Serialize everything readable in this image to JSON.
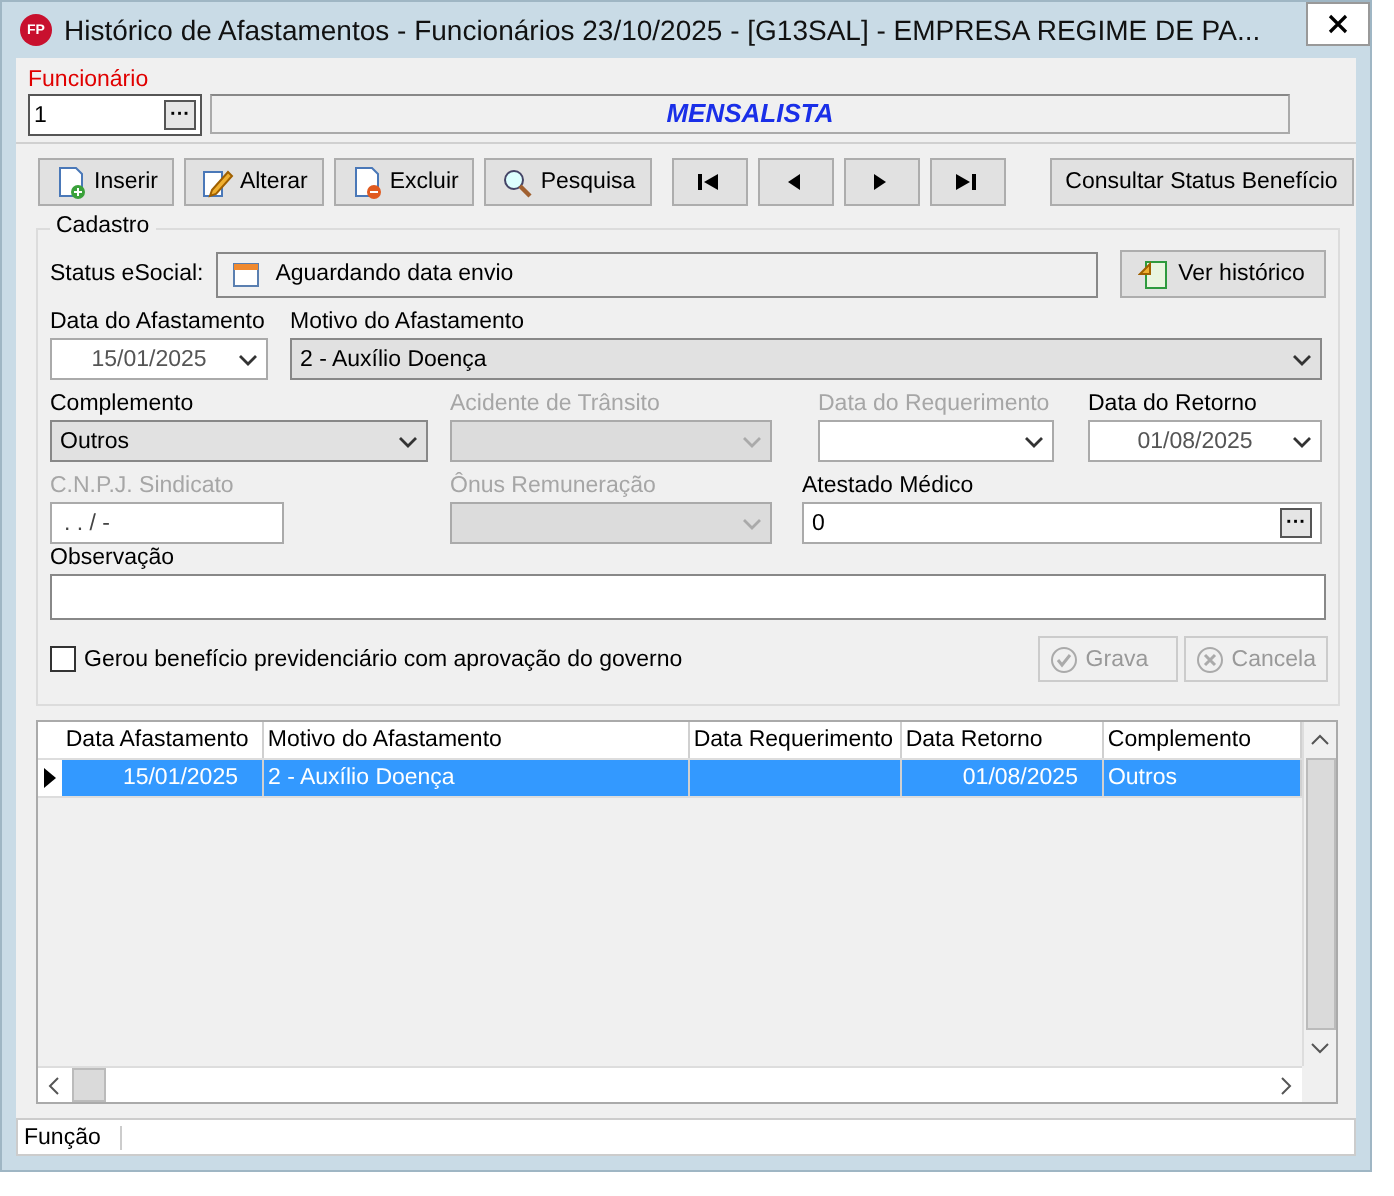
{
  "window": {
    "logo": "FP",
    "title": "Histórico de Afastamentos - Funcionários  23/10/2025 - [G13SAL] - EMPRESA REGIME DE PA..."
  },
  "funcionario": {
    "label": "Funcionário",
    "value": "1",
    "lookup": "···",
    "description": "MENSALISTA"
  },
  "toolbar": [
    {
      "kind": "insert",
      "label": "Inserir"
    },
    {
      "kind": "edit",
      "label": "Alterar"
    },
    {
      "kind": "delete",
      "label": "Excluir"
    },
    {
      "kind": "search",
      "label": "Pesquisa"
    },
    {
      "kind": "first"
    },
    {
      "kind": "prev"
    },
    {
      "kind": "next"
    },
    {
      "kind": "last"
    },
    {
      "kind": "text",
      "label": "Consultar Status Benefício"
    }
  ],
  "cadastro": {
    "title": "Cadastro",
    "status_label": "Status eSocial:",
    "status_value": "Aguardando data envio",
    "history_button": "Ver histórico",
    "rows": [
      [
        {
          "kind": "date",
          "label": "Data do Afastamento",
          "value": "15/01/2025",
          "disabled": false
        },
        {
          "kind": "select",
          "label": "Motivo do Afastamento",
          "value": "2  -  Auxílio Doença",
          "disabled": false
        }
      ],
      [
        {
          "kind": "select",
          "label": "Complemento",
          "value": "Outros",
          "disabled": false
        },
        {
          "kind": "select",
          "label": "Acidente de Trânsito",
          "disabled": true
        },
        {
          "kind": "date",
          "label": "Data do Requerimento",
          "disabled": true
        },
        {
          "kind": "date",
          "label": "Data do Retorno",
          "value": "01/08/2025",
          "disabled": false
        }
      ],
      [
        {
          "kind": "text",
          "label": "C.N.P.J. Sindicato",
          "value": " .  .  /    -",
          "disabled": true
        },
        {
          "kind": "select",
          "label": "Ônus Remuneração",
          "disabled": true
        },
        {
          "kind": "lookup",
          "label": "Atestado Médico",
          "value": "0",
          "lookup": "···",
          "disabled": false
        }
      ]
    ],
    "observacao_label": "Observação",
    "checkbox": {
      "label": "Gerou benefício previdenciário com aprovação do governo",
      "checked": false
    },
    "actions": [
      {
        "kind": "save",
        "label": "Grava",
        "disabled": true
      },
      {
        "kind": "cancel",
        "label": "Cancela",
        "disabled": true
      }
    ]
  },
  "grid": {
    "columns": [
      "Data Afastamento",
      "Motivo do Afastamento",
      "Data Requerimento",
      "Data Retorno",
      "Complemento"
    ],
    "rows": [
      {
        "selected": true,
        "cells": [
          "15/01/2025",
          "2  -  Auxílio Doença",
          "",
          "01/08/2025",
          "Outros"
        ]
      }
    ]
  },
  "status_bar": "Função"
}
